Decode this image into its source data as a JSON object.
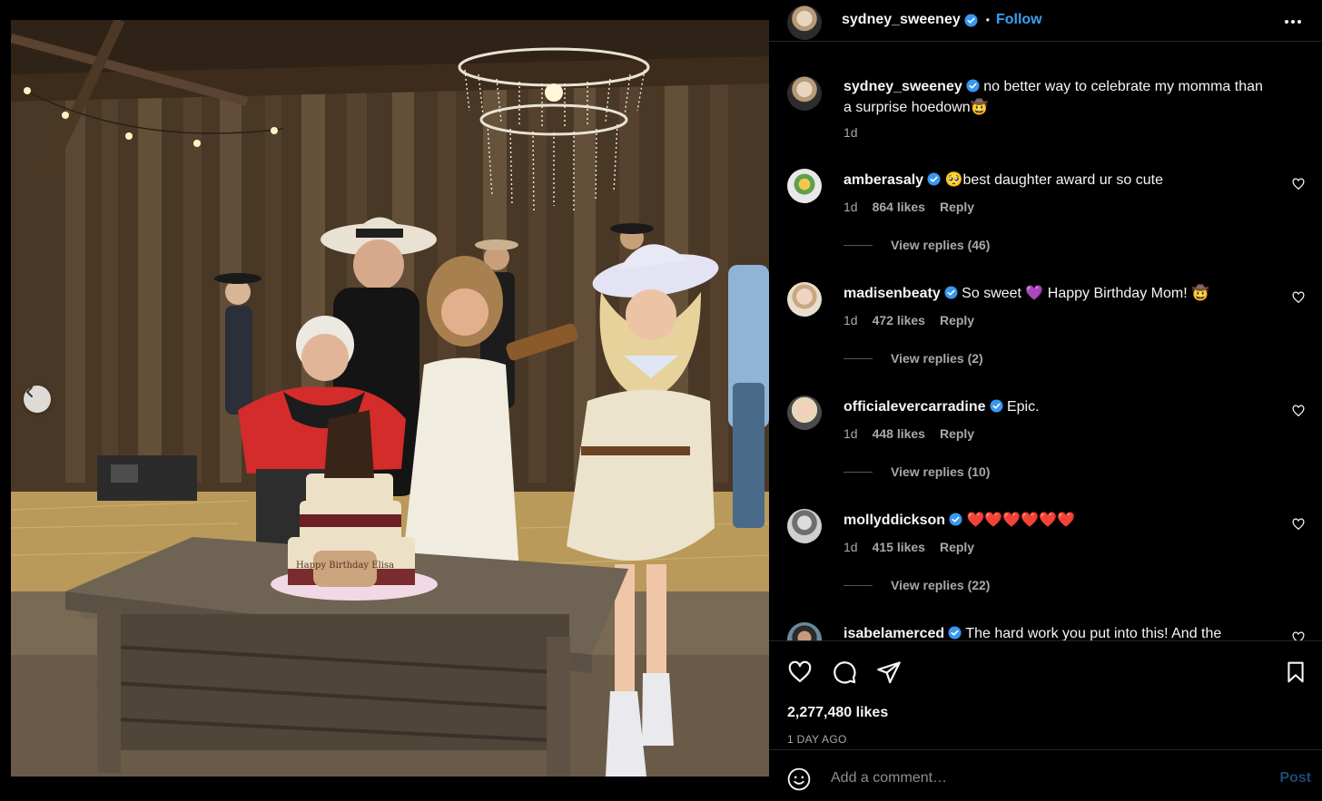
{
  "header": {
    "username": "sydney_sweeney",
    "separator": "•",
    "follow_label": "Follow"
  },
  "caption": {
    "username": "sydney_sweeney",
    "text": "no better way to celebrate my momma than a surprise hoedown🤠",
    "time": "1d"
  },
  "comments": [
    {
      "username": "amberasaly",
      "text": "🥺best daughter award ur so cute",
      "time": "1d",
      "likes": "864 likes",
      "reply_label": "Reply",
      "view_replies": "View replies (46)"
    },
    {
      "username": "madisenbeaty",
      "text": "So sweet 💜 Happy Birthday Mom! 🤠",
      "time": "1d",
      "likes": "472 likes",
      "reply_label": "Reply",
      "view_replies": "View replies (2)"
    },
    {
      "username": "officialevercarradine",
      "text": "Epic.",
      "time": "1d",
      "likes": "448 likes",
      "reply_label": "Reply",
      "view_replies": "View replies (10)"
    },
    {
      "username": "mollyddickson",
      "text": "❤️❤️❤️❤️❤️❤️",
      "time": "1d",
      "likes": "415 likes",
      "reply_label": "Reply",
      "view_replies": "View replies (22)"
    },
    {
      "username": "isabelamerced",
      "text": "The hard work you put into this! And the"
    }
  ],
  "post": {
    "likes": "2,277,480 likes",
    "posted_ago": "1 DAY AGO"
  },
  "composer": {
    "placeholder": "Add a comment…",
    "post_label": "Post"
  },
  "photo": {
    "cake_text": "Happy Birthday Elisa"
  },
  "icons": {
    "like": "heart-icon",
    "comment": "comment-bubble-icon",
    "share": "paper-plane-icon",
    "save": "bookmark-icon",
    "more": "more-horizontal-icon",
    "emoji": "smiley-icon",
    "verified": "verified-badge-icon",
    "prev": "chevron-left-icon"
  },
  "colors": {
    "background": "#000000",
    "follow": "#3aa0f5",
    "verified": "#3897f0",
    "post_disabled": "#1c4a72",
    "muted_text": "#a8a8a8"
  }
}
